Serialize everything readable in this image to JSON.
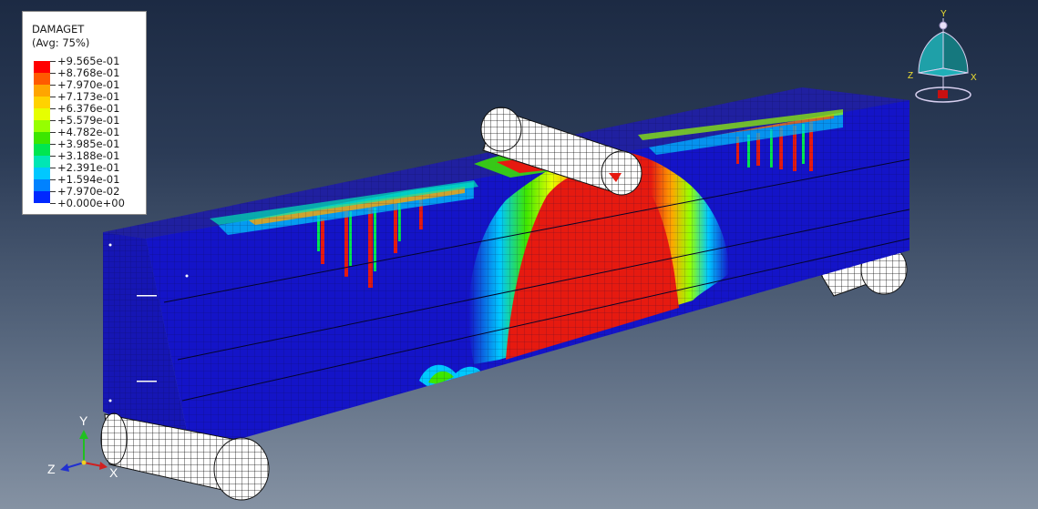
{
  "legend": {
    "variable": "DAMAGET",
    "averaging": "(Avg: 75%)",
    "colors": [
      "#ff0000",
      "#ff5a00",
      "#ffa500",
      "#ffd200",
      "#e6ff00",
      "#96ff00",
      "#3ce600",
      "#00e650",
      "#00e6b4",
      "#00c8ff",
      "#0082ff",
      "#0028ff"
    ],
    "values": [
      "+9.565e-01",
      "+8.768e-01",
      "+7.970e-01",
      "+7.173e-01",
      "+6.376e-01",
      "+5.579e-01",
      "+4.782e-01",
      "+3.985e-01",
      "+3.188e-01",
      "+2.391e-01",
      "+1.594e-01",
      "+7.970e-02",
      "+0.000e+00"
    ]
  },
  "triad": {
    "y_label": "Y",
    "z_label": "Z",
    "x_label": "X"
  },
  "view_cube": {
    "y_label": "Y",
    "z_label": "Z",
    "x_label": "X"
  },
  "colors": {
    "beam": "#1414c8",
    "damage_max": "#e61a10",
    "roller": "#ffffff"
  }
}
